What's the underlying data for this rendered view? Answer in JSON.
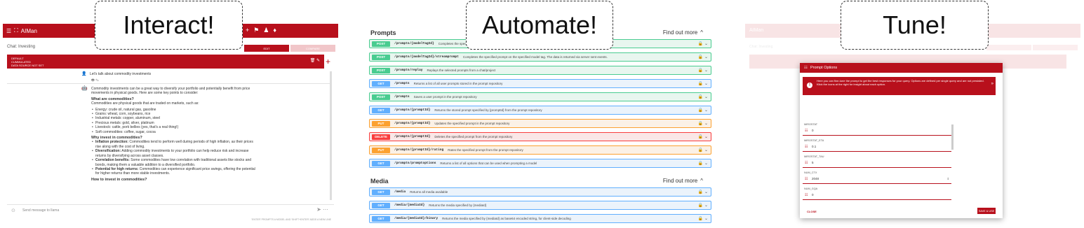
{
  "callouts": {
    "interact": "Interact!",
    "automate": "Automate!",
    "tune": "Tune!"
  },
  "chat": {
    "app_title": "AIMan",
    "chat_title": "Chat: Investing",
    "tabs": [
      "EDIT",
      "COMPARE"
    ],
    "card": {
      "line1": "DEFAULT",
      "line2": "CUMMULATED",
      "line3": "DATA SOURCE NOT SET"
    },
    "user_message": "Let's talk about commodity investments",
    "intro": "Commodity investments can be a great way to diversify your portfolio and potentially benefit from price movements in physical goods. Here are some key points to consider:",
    "h1": "What are commodities?",
    "p1": "Commodities are physical goods that are traded on markets, such as:",
    "list1": [
      "Energy: crude oil, natural gas, gasoline",
      "Grains: wheat, corn, soybeans, rice",
      "Industrial metals: copper, aluminum, steel",
      "Precious metals: gold, silver, platinum",
      "Livestock: cattle, pork bellies (yes, that's a real thing!)",
      "Soft commodities: coffee, sugar, cocoa"
    ],
    "h2": "Why invest in commodities?",
    "list2": [
      {
        "b": "Inflation protection:",
        "t": " Commodities tend to perform well during periods of high inflation, as their prices rise along with the cost of living."
      },
      {
        "b": "Diversification:",
        "t": " Adding commodity investments to your portfolio can help reduce risk and increase returns by diversifying across asset classes."
      },
      {
        "b": "Correlation benefits:",
        "t": " Some commodities have low correlation with traditional assets like stocks and bonds, making them a valuable addition to a diversified portfolio."
      },
      {
        "b": "Potential for high returns:",
        "t": " Commodities can experience significant price swings, offering the potential for higher returns than more stable investments."
      }
    ],
    "h3": "How to invest in commodities?",
    "input_placeholder": "Send message to llama",
    "hint": "'ENTER' PROMPTS A MODEL AND 'SHIFT+ENTER' ADDS A NEW LINE"
  },
  "api": {
    "prompts_title": "Prompts",
    "media_title": "Media",
    "find_more": "Find out more",
    "prompts": [
      {
        "method": "POST",
        "cls": "post",
        "path": "/prompts/{modelTagId}",
        "desc": "Completes the specified prompt on the specified model tag"
      },
      {
        "method": "POST",
        "cls": "post",
        "path": "/prompts/{modelTagId}/streamprompt",
        "desc": "Completes the specified prompt on the specified model tag. The data is returned via server sent events."
      },
      {
        "method": "POST",
        "cls": "post",
        "path": "/prompts/replay",
        "desc": "Replays the selected prompts from a chat/project"
      },
      {
        "method": "GET",
        "cls": "get",
        "path": "/prompts",
        "desc": "Returns a list of all user prompts stored in the prompt repository"
      },
      {
        "method": "POST",
        "cls": "post",
        "path": "/prompts",
        "desc": "Saves a user prompt in the prompt repository"
      },
      {
        "method": "GET",
        "cls": "get",
        "path": "/prompts/{promptId}",
        "desc": "Returns the stored prompt specified by {promptId} from the prompt repository"
      },
      {
        "method": "PUT",
        "cls": "put",
        "path": "/prompts/{promptId}",
        "desc": "Updates the specified prompt in the prompt repository"
      },
      {
        "method": "DELETE",
        "cls": "del",
        "path": "/prompts/{promptId}",
        "desc": "Deletes the specified prompt from the prompt repository"
      },
      {
        "method": "PUT",
        "cls": "put",
        "path": "/prompts/{promptId}/rating",
        "desc": "Rates the specified prompt from the prompt repository"
      },
      {
        "method": "GET",
        "cls": "get",
        "path": "/prompts/promptoptions",
        "desc": "Returns a list of all options that can be used when prompting a model"
      }
    ],
    "media": [
      {
        "method": "GET",
        "cls": "get",
        "path": "/media",
        "desc": "Returns all media available"
      },
      {
        "method": "GET",
        "cls": "get",
        "path": "/media/{mediaId}",
        "desc": "Returns the media specified by {mediaId}"
      },
      {
        "method": "GET",
        "cls": "get",
        "path": "/media/{mediaId}/binary",
        "desc": "Returns the media specified by {mediaId} as base64 encoded string, for client-side decoding"
      }
    ]
  },
  "tune": {
    "dialog_title": "Prompt Options",
    "alert": "Here you can fine-tune the prompt to get the best responses for your query. Options are defined per single query and are not persisted. Klick the icons at the right for insight about each option.",
    "fields": [
      {
        "label": "MIROSTAT",
        "value": "0"
      },
      {
        "label": "MIROSTAT_ETA",
        "value": "0.1"
      },
      {
        "label": "MIROSTAT_TAU",
        "value": "5"
      },
      {
        "label": "NUM_CTX",
        "value": "2048"
      },
      {
        "label": "NUM_GQA",
        "value": "0"
      }
    ],
    "close": "CLOSE",
    "save": "SAVE & USE"
  }
}
